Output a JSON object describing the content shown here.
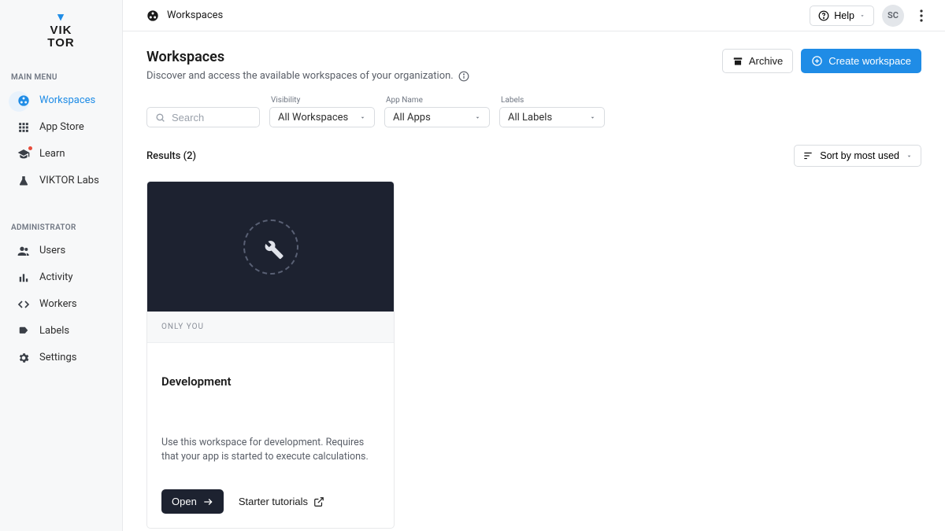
{
  "brand": {
    "line1": "VIK",
    "line2": "TOR"
  },
  "sidebar": {
    "sections": {
      "main_menu": "MAIN MENU",
      "administrator": "ADMINISTRATOR"
    },
    "items": {
      "workspaces": "Workspaces",
      "appstore": "App Store",
      "learn": "Learn",
      "labs": "VIKTOR Labs",
      "users": "Users",
      "activity": "Activity",
      "workers": "Workers",
      "labels": "Labels",
      "settings": "Settings"
    }
  },
  "topbar": {
    "breadcrumb": "Workspaces",
    "help": "Help",
    "avatar_initials": "SC"
  },
  "page": {
    "title": "Workspaces",
    "subtitle": "Discover and access the available workspaces of your organization."
  },
  "actions": {
    "archive": "Archive",
    "create": "Create workspace"
  },
  "filters": {
    "search_placeholder": "Search",
    "visibility": {
      "label": "Visibility",
      "value": "All Workspaces"
    },
    "app": {
      "label": "App Name",
      "value": "All Apps"
    },
    "labels": {
      "label": "Labels",
      "value": "All Labels"
    }
  },
  "results": {
    "label": "Results (2)",
    "sort": "Sort by most used"
  },
  "card": {
    "strip": "ONLY YOU",
    "title": "Development",
    "description": "Use this workspace for development. Requires that your app is started to execute calculations.",
    "open": "Open",
    "tutorials": "Starter tutorials"
  }
}
